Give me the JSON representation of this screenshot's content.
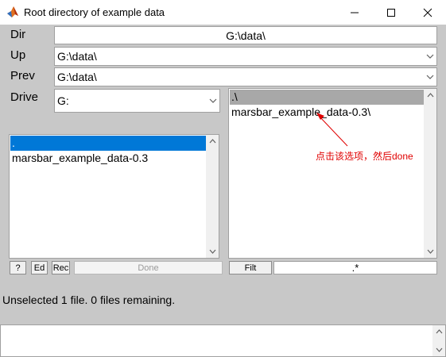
{
  "window": {
    "title": "Root directory of example data"
  },
  "labels": {
    "dir": "Dir",
    "up": "Up",
    "prev": "Prev",
    "drive": "Drive"
  },
  "fields": {
    "dir_value": "G:\\data\\",
    "up_value": "G:\\data\\",
    "prev_value": "G:\\data\\",
    "drive_value": "G:"
  },
  "left_list": {
    "items": [
      ".",
      "marsbar_example_data-0.3"
    ],
    "selected_index": 0,
    "selected_color": "#0078d7"
  },
  "right_list": {
    "items": [
      ".\\",
      "marsbar_example_data-0.3\\"
    ],
    "selected_index": 0,
    "selected_color": "#a8a8a8"
  },
  "buttons": {
    "help": "?",
    "edit": "Ed",
    "rec": "Rec",
    "done": "Done",
    "filt": "Filt"
  },
  "filter_value": ".*",
  "status_text": "Unselected 1 file. 0 files remaining.",
  "annotation": {
    "text": "点击该选项，然后done",
    "color": "#e00000"
  }
}
